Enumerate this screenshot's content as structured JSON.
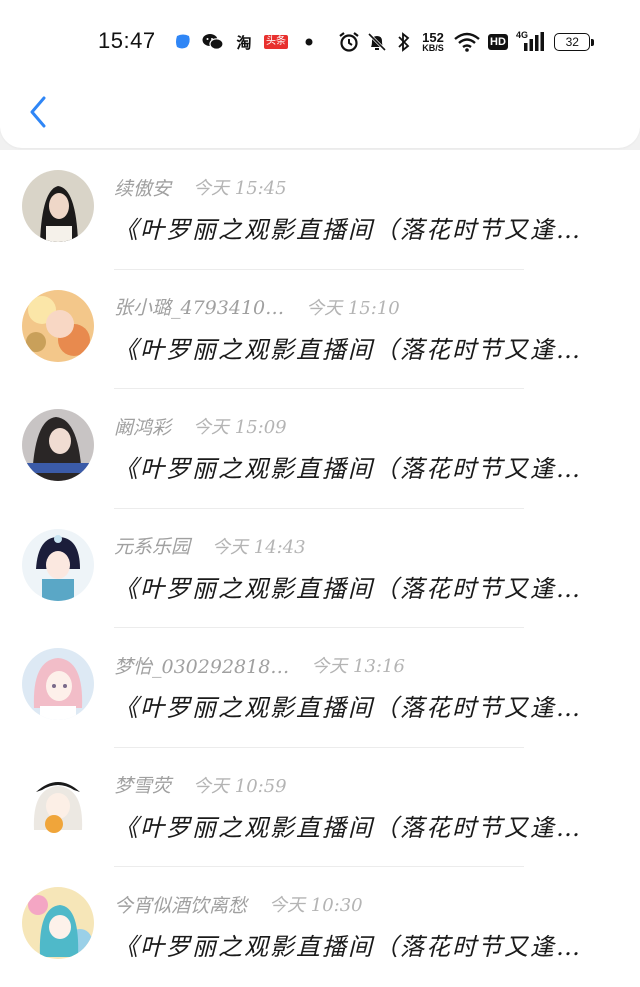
{
  "status_bar": {
    "time": "15:47",
    "app_badges": [
      "bubble-icon",
      "wechat-icon",
      "taobao-icon",
      "toutiao-icon",
      "dot-icon"
    ],
    "taobao_label": "淘",
    "toutiao_label": "头条",
    "net_speed_value": "152",
    "net_speed_unit": "KB/S",
    "hd_label": "HD",
    "signal_label": "4G",
    "battery": "32",
    "accent_color": "#2f86f6"
  },
  "header": {
    "back_icon": "chevron-left-icon",
    "back_color": "#2f86f6"
  },
  "messages": [
    {
      "name": "续傲安",
      "time": "今天 15:45",
      "preview": "《叶罗丽之观影直播间（落花时节又逢…"
    },
    {
      "name": "张小璐_4793410…",
      "time": "今天 15:10",
      "preview": "《叶罗丽之观影直播间（落花时节又逢…"
    },
    {
      "name": "阚鸿彩",
      "time": "今天 15:09",
      "preview": "《叶罗丽之观影直播间（落花时节又逢…"
    },
    {
      "name": "元系乐园",
      "time": "今天 14:43",
      "preview": "《叶罗丽之观影直播间（落花时节又逢…"
    },
    {
      "name": "梦怡_030292818…",
      "time": "今天 13:16",
      "preview": "《叶罗丽之观影直播间（落花时节又逢…"
    },
    {
      "name": "梦雪荧",
      "time": "今天 10:59",
      "preview": "《叶罗丽之观影直播间（落花时节又逢…"
    },
    {
      "name": "今宵似酒饮离愁",
      "time": "今天 10:30",
      "preview": "《叶罗丽之观影直播间（落花时节又逢…"
    }
  ]
}
